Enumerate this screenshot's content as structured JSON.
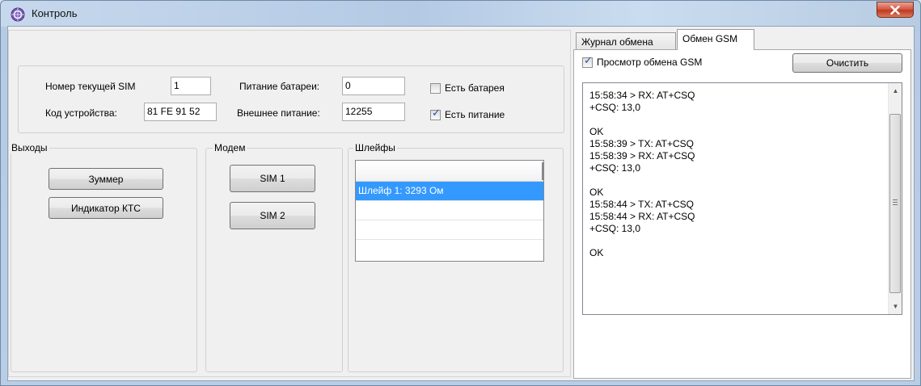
{
  "window": {
    "title": "Контроль",
    "close_label": "X"
  },
  "status_group": {
    "sim_label": "Номер текущей SIM",
    "sim_value": "1",
    "device_code_label": "Код устройства:",
    "device_code_value": "81 FE 91 52",
    "battery_power_label": "Питание батареи:",
    "battery_power_value": "0",
    "external_power_label": "Внешнее питание:",
    "external_power_value": "12255",
    "has_battery": {
      "label": "Есть батарея",
      "checked": false
    },
    "has_power": {
      "label": "Есть питание",
      "checked": true
    }
  },
  "outputs": {
    "legend": "Выходы",
    "buttons": [
      "Зуммер",
      "Индикатор КТС"
    ]
  },
  "modem": {
    "legend": "Модем",
    "buttons": [
      "SIM 1",
      "SIM 2"
    ]
  },
  "loops": {
    "legend": "Шлейфы",
    "rows": [
      "Шлейф 1: 3293 Ом",
      "",
      "",
      ""
    ]
  },
  "right_panel": {
    "tabs": [
      {
        "label": "Журнал обмена",
        "active": false
      },
      {
        "label": "Обмен GSM",
        "active": true
      }
    ],
    "view_gsm": {
      "label": "Просмотр обмена GSM",
      "checked": true
    },
    "clear_button": "Очистить",
    "log_text": "15:58:34 > RX: AT+CSQ\n+CSQ: 13,0\n\nOK\n15:58:39 > TX: AT+CSQ\n15:58:39 > RX: AT+CSQ\n+CSQ: 13,0\n\nOK\n15:58:44 > TX: AT+CSQ\n15:58:44 > RX: AT+CSQ\n+CSQ: 13,0\n\nOK"
  },
  "colors": {
    "selection": "#3399ff",
    "close_button": "#c1391f",
    "check_mark": "#2a4ea8"
  }
}
